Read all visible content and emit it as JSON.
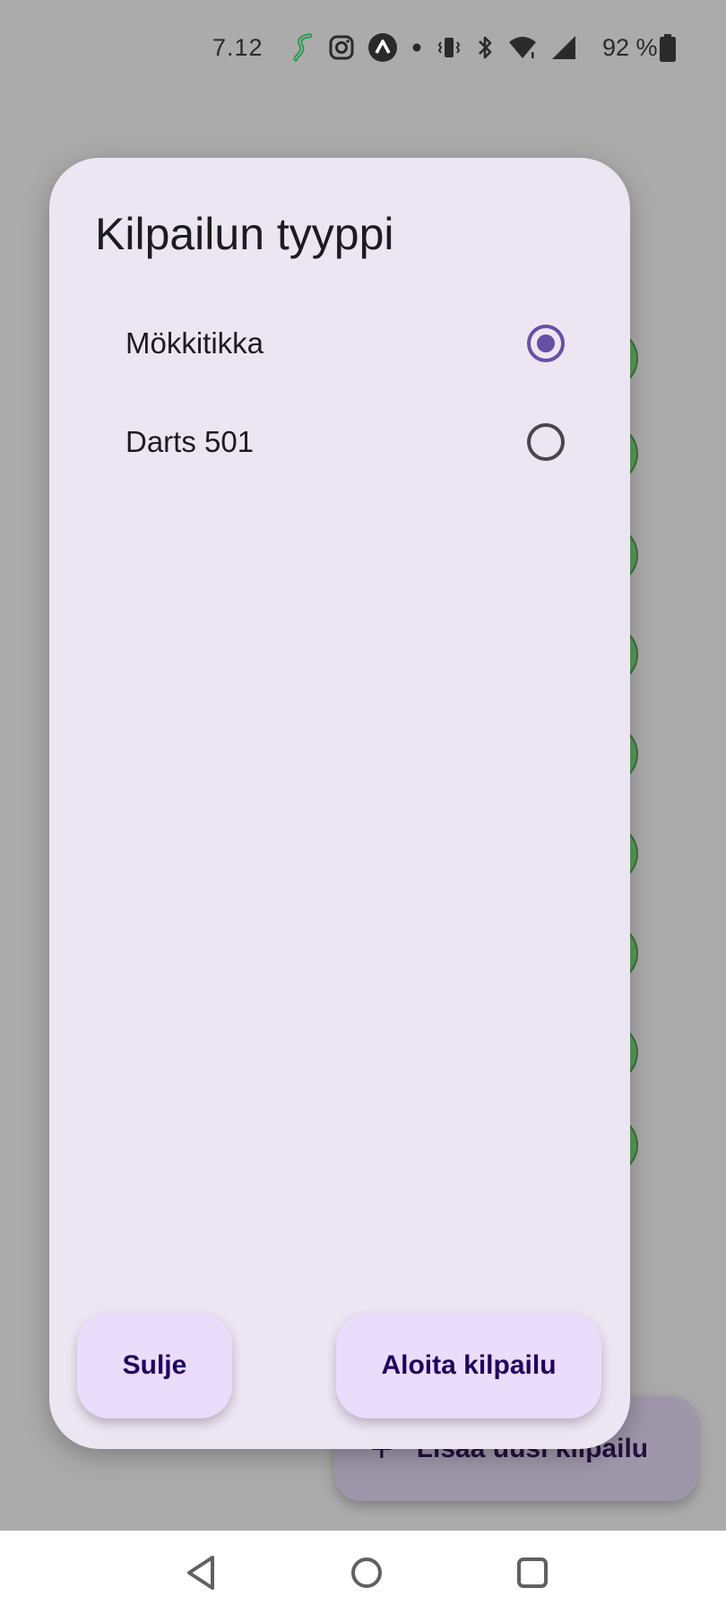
{
  "status_bar": {
    "time": "7.12",
    "battery_percent": "92 %",
    "icons": [
      "s-app-icon",
      "instagram-icon",
      "expo-icon",
      "dot-icon",
      "vibrate-icon",
      "bluetooth-icon",
      "wifi-icon",
      "signal-icon",
      "battery-icon"
    ]
  },
  "dialog": {
    "title": "Kilpailun tyyppi",
    "options": [
      {
        "label": "Mökkitikka",
        "selected": true
      },
      {
        "label": "Darts 501",
        "selected": false
      }
    ],
    "close_label": "Sulje",
    "start_label": "Aloita kilpailu"
  },
  "background": {
    "fab_label": "Lisää uusi kilpailu",
    "fab_icon": "plus-icon",
    "list_item_color": "#5a9a59"
  },
  "nav_bar": {
    "icons": [
      "back-icon",
      "home-icon",
      "recents-icon"
    ]
  },
  "colors": {
    "accent": "#6750a4",
    "dialog_bg": "#ece6f3",
    "button_bg": "#eadcfb",
    "scrim": "#ababab"
  }
}
